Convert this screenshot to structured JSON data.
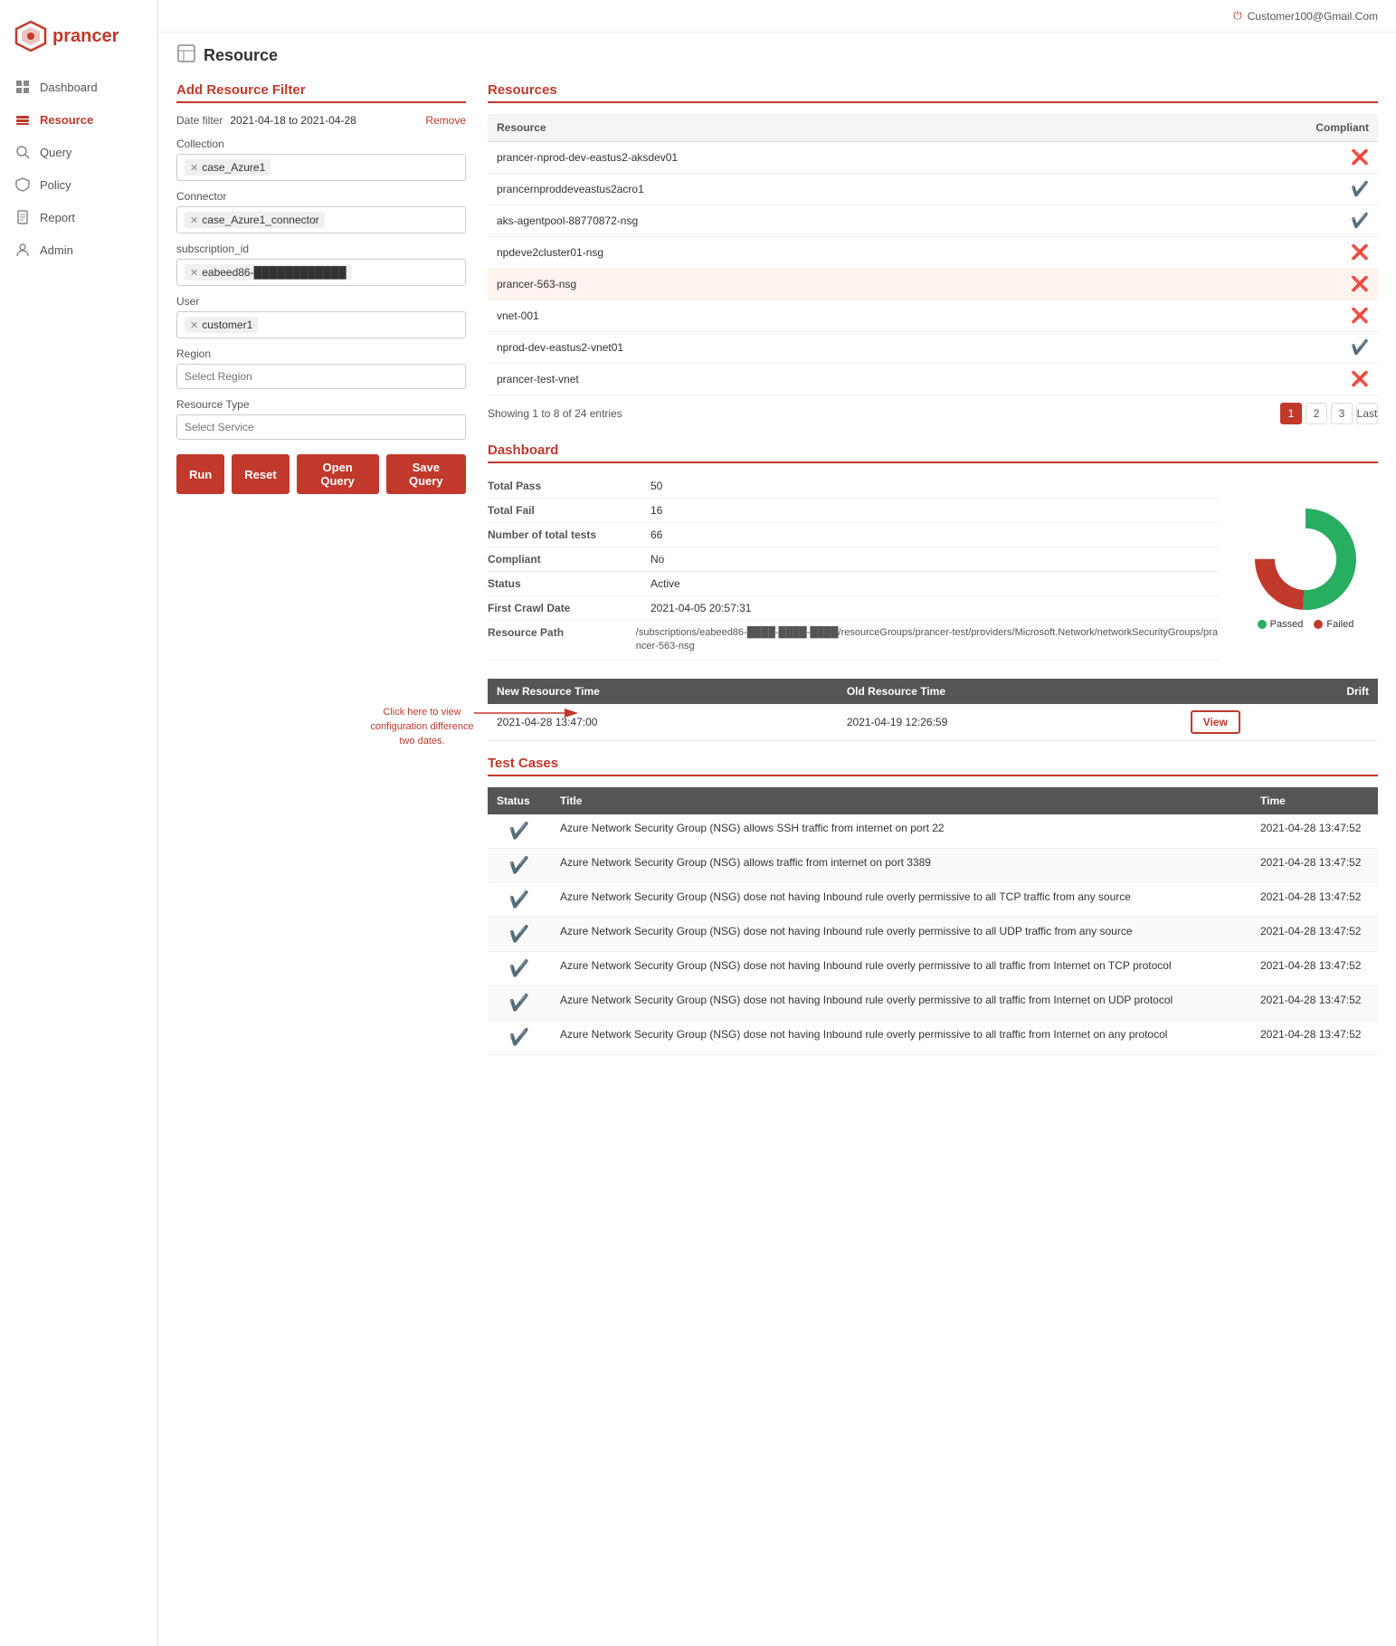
{
  "app": {
    "name": "prancer",
    "user": "Customer100@Gmail.Com"
  },
  "sidebar": {
    "items": [
      {
        "id": "dashboard",
        "label": "Dashboard",
        "icon": "grid"
      },
      {
        "id": "resource",
        "label": "Resource",
        "icon": "layers",
        "active": true
      },
      {
        "id": "query",
        "label": "Query",
        "icon": "search-circle"
      },
      {
        "id": "policy",
        "label": "Policy",
        "icon": "shield"
      },
      {
        "id": "report",
        "label": "Report",
        "icon": "file"
      },
      {
        "id": "admin",
        "label": "Admin",
        "icon": "person"
      }
    ]
  },
  "page": {
    "title": "Resource",
    "add_filter_title": "Add Resource Filter",
    "resources_title": "Resources",
    "dashboard_title": "Dashboard",
    "test_cases_title": "Test Cases"
  },
  "filter": {
    "date_label": "Date filter",
    "date_value": "2021-04-18 to 2021-04-28",
    "remove_label": "Remove",
    "collection_label": "Collection",
    "collection_value": "case_Azure1",
    "connector_label": "Connector",
    "connector_value": "case_Azure1_connector",
    "subscription_label": "subscription_id",
    "subscription_value": "eabeed86-████████████",
    "user_label": "User",
    "user_value": "customer1",
    "region_label": "Region",
    "region_placeholder": "Select Region",
    "resource_type_label": "Resource Type",
    "service_placeholder": "Select Service",
    "buttons": {
      "run": "Run",
      "reset": "Reset",
      "open_query": "Open Query",
      "save_query": "Save Query"
    }
  },
  "resources_table": {
    "columns": [
      "Resource",
      "Compliant"
    ],
    "rows": [
      {
        "name": "prancer-nprod-dev-eastus2-aksdev01",
        "compliant": "fail"
      },
      {
        "name": "prancernproddeveastus2acro1",
        "compliant": "pass"
      },
      {
        "name": "aks-agentpool-88770872-nsg",
        "compliant": "pass"
      },
      {
        "name": "npdeve2cluster01-nsg",
        "compliant": "fail"
      },
      {
        "name": "prancer-563-nsg",
        "compliant": "fail",
        "selected": true
      },
      {
        "name": "vnet-001",
        "compliant": "fail"
      },
      {
        "name": "nprod-dev-eastus2-vnet01",
        "compliant": "pass"
      },
      {
        "name": "prancer-test-vnet",
        "compliant": "fail"
      }
    ],
    "pagination": {
      "info": "Showing 1 to 8 of 24 entries",
      "pages": [
        "1",
        "2",
        "3",
        "Last"
      ]
    }
  },
  "dashboard": {
    "stats": [
      {
        "label": "Total Pass",
        "value": "50"
      },
      {
        "label": "Total Fail",
        "value": "16"
      },
      {
        "label": "Number of total tests",
        "value": "66"
      },
      {
        "label": "Compliant",
        "value": "No"
      },
      {
        "label": "Status",
        "value": "Active"
      },
      {
        "label": "First Crawl Date",
        "value": "2021-04-05 20:57:31"
      },
      {
        "label": "Resource Path",
        "value": "/subscriptions/eabeed86-████-████-████/resourceGroups/prancer-test/providers/Microsoft.Network/networkSecurityGroups/prancer-563-nsg"
      }
    ],
    "chart": {
      "pass": 50,
      "fail": 16,
      "total": 66,
      "pass_color": "#27ae60",
      "fail_color": "#c0392b"
    },
    "legend": {
      "passed": "Passed",
      "failed": "Failed"
    }
  },
  "drift": {
    "columns": [
      "New Resource Time",
      "Old Resource Time",
      "Drift"
    ],
    "rows": [
      {
        "new_time": "2021-04-28 13:47:00",
        "old_time": "2021-04-19 12:26:59",
        "action": "View"
      }
    ],
    "hint": "Click here to view configuration difference two dates."
  },
  "test_cases": {
    "columns": [
      "Status",
      "Title",
      "Time"
    ],
    "rows": [
      {
        "status": "pass",
        "title": "Azure Network Security Group (NSG) allows SSH traffic from internet on port 22",
        "time": "2021-04-28 13:47:52"
      },
      {
        "status": "pass",
        "title": "Azure Network Security Group (NSG) allows traffic from internet on port 3389",
        "time": "2021-04-28 13:47:52"
      },
      {
        "status": "pass",
        "title": "Azure Network Security Group (NSG) dose not having Inbound rule overly permissive to all TCP traffic from any source",
        "time": "2021-04-28 13:47:52"
      },
      {
        "status": "pass",
        "title": "Azure Network Security Group (NSG) dose not having Inbound rule overly permissive to all UDP traffic from any source",
        "time": "2021-04-28 13:47:52"
      },
      {
        "status": "pass",
        "title": "Azure Network Security Group (NSG) dose not having Inbound rule overly permissive to all traffic from Internet on TCP protocol",
        "time": "2021-04-28 13:47:52"
      },
      {
        "status": "pass",
        "title": "Azure Network Security Group (NSG) dose not having Inbound rule overly permissive to all traffic from Internet on UDP protocol",
        "time": "2021-04-28 13:47:52"
      },
      {
        "status": "pass",
        "title": "Azure Network Security Group (NSG) dose not having Inbound rule overly permissive to all traffic from Internet on any protocol",
        "time": "2021-04-28 13:47:52"
      }
    ]
  }
}
